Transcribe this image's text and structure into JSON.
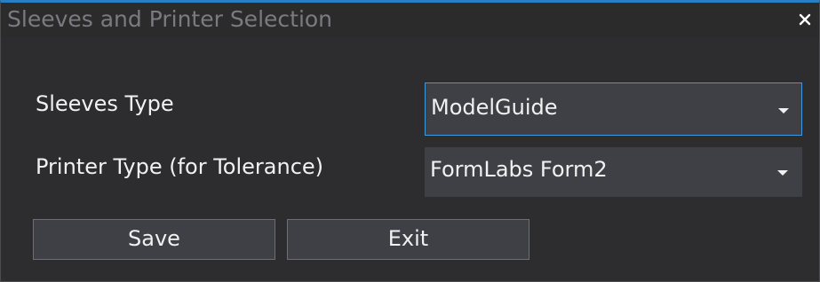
{
  "window": {
    "title": "Sleeves and Printer Selection",
    "close_glyph": "×",
    "accent_color": "#2a7fc0"
  },
  "form": {
    "sleeves_type": {
      "label": "Sleeves Type",
      "value": "ModelGuide",
      "focused": true
    },
    "printer_type": {
      "label": "Printer Type (for Tolerance)",
      "value": "FormLabs Form2",
      "focused": false
    }
  },
  "buttons": {
    "save_label": "Save",
    "exit_label": "Exit"
  },
  "icons": {
    "close": "close-icon",
    "dropdown": "chevron-down-icon"
  }
}
